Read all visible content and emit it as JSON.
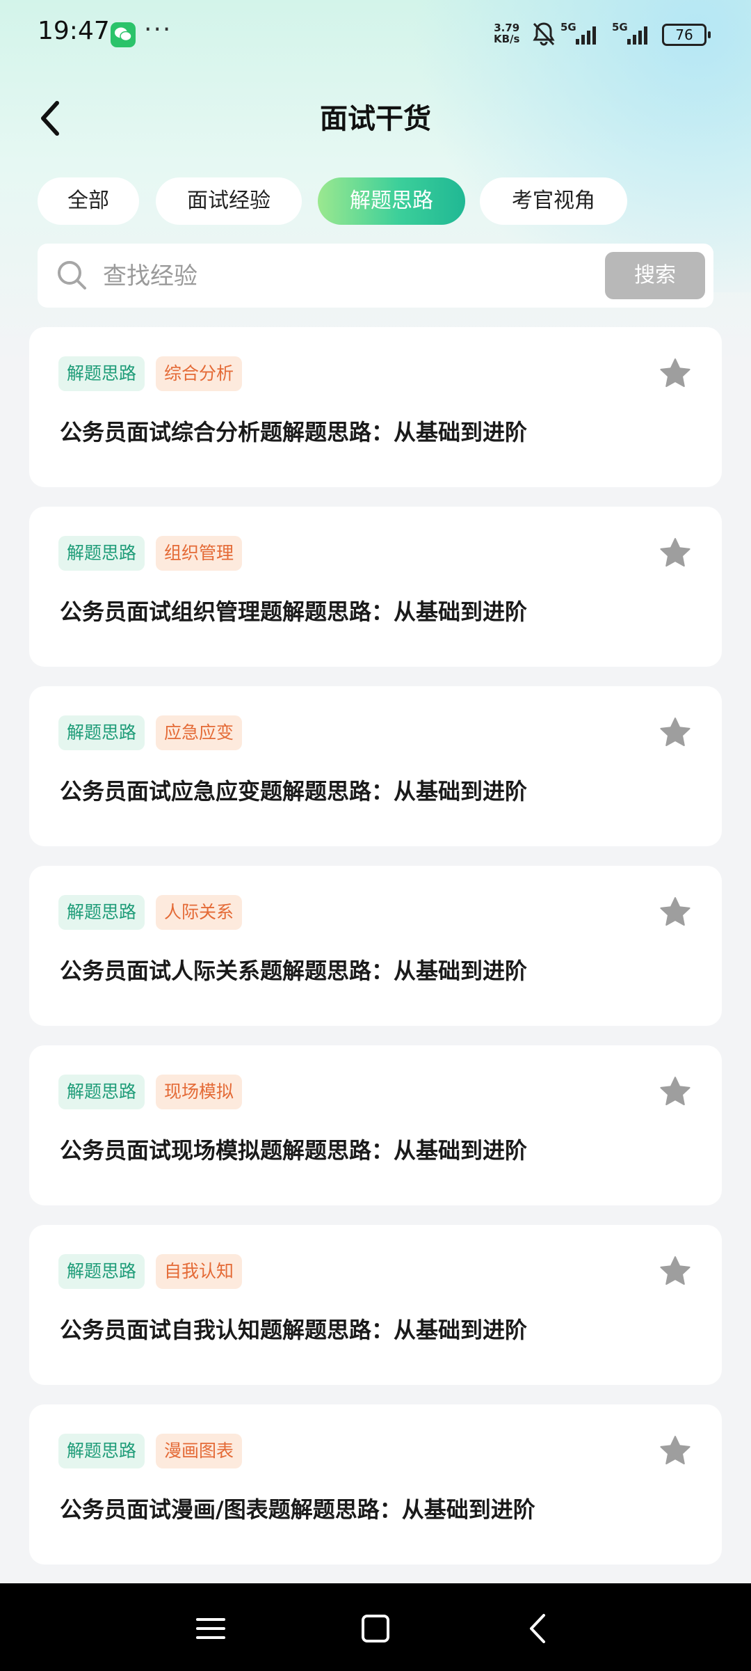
{
  "status_bar": {
    "time": "19:47",
    "more": "···",
    "net_speed_value": "3.79",
    "net_speed_unit": "KB/s",
    "battery": "76",
    "sig1_label": "5G",
    "sig2_label": "5G"
  },
  "header": {
    "title": "面试干货",
    "back_icon": "chevron-left-icon"
  },
  "tabs": [
    {
      "label": "全部",
      "active": false
    },
    {
      "label": "面试经验",
      "active": false
    },
    {
      "label": "解题思路",
      "active": true
    },
    {
      "label": "考官视角",
      "active": false
    }
  ],
  "search": {
    "placeholder": "查找经验",
    "value": "",
    "button": "搜索"
  },
  "cards": [
    {
      "tag1": "解题思路",
      "tag2": "综合分析",
      "title": "公务员面试综合分析题解题思路：从基础到进阶"
    },
    {
      "tag1": "解题思路",
      "tag2": "组织管理",
      "title": "公务员面试组织管理题解题思路：从基础到进阶"
    },
    {
      "tag1": "解题思路",
      "tag2": "应急应变",
      "title": "公务员面试应急应变题解题思路：从基础到进阶"
    },
    {
      "tag1": "解题思路",
      "tag2": "人际关系",
      "title": "公务员面试人际关系题解题思路：从基础到进阶"
    },
    {
      "tag1": "解题思路",
      "tag2": "现场模拟",
      "title": "公务员面试现场模拟题解题思路：从基础到进阶"
    },
    {
      "tag1": "解题思路",
      "tag2": "自我认知",
      "title": "公务员面试自我认知题解题思路：从基础到进阶"
    },
    {
      "tag1": "解题思路",
      "tag2": "漫画图表",
      "title": "公务员面试漫画/图表题解题思路：从基础到进阶"
    }
  ],
  "colors": {
    "accent": "#3ccf9a",
    "tag_green_text": "#1e9c78",
    "tag_orange_text": "#e46a36",
    "star": "#9e9e9e"
  }
}
